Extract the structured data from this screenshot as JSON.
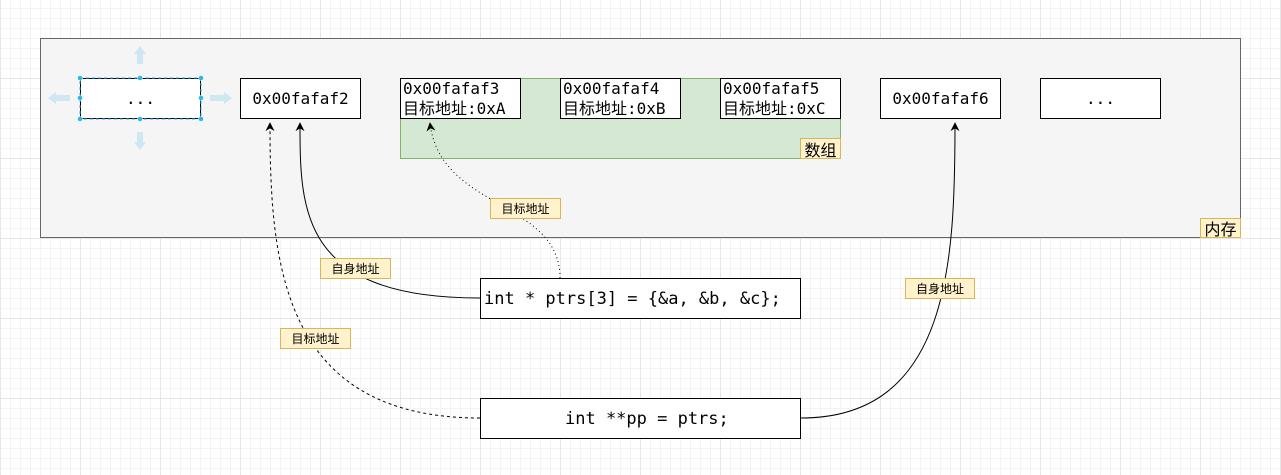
{
  "memory": {
    "label": "内存"
  },
  "array": {
    "label": "数组"
  },
  "cells": [
    {
      "text": "..."
    },
    {
      "text": "0x00fafaf2"
    },
    {
      "address": "0x00fafaf3",
      "target": "目标地址:0xA"
    },
    {
      "address": "0x00fafaf4",
      "target": "目标地址:0xB"
    },
    {
      "address": "0x00fafaf5",
      "target": "目标地址:0xC"
    },
    {
      "text": "0x00fafaf6"
    },
    {
      "text": "..."
    }
  ],
  "code": {
    "ptrs_decl": "int * ptrs[3] = {&a, &b, &c};",
    "pp_decl": "int **pp = ptrs;"
  },
  "labels": {
    "target_array": "目标地址",
    "self_ptrs": "自身地址",
    "target_pp": "目标地址",
    "self_pp": "自身地址"
  },
  "colors": {
    "memory_fill": "#f5f5f5",
    "array_fill": "#d5e8d4",
    "array_border": "#82b366",
    "tag_fill": "#fff2cc",
    "tag_border": "#d6b656",
    "selection": "#29b6f2"
  }
}
